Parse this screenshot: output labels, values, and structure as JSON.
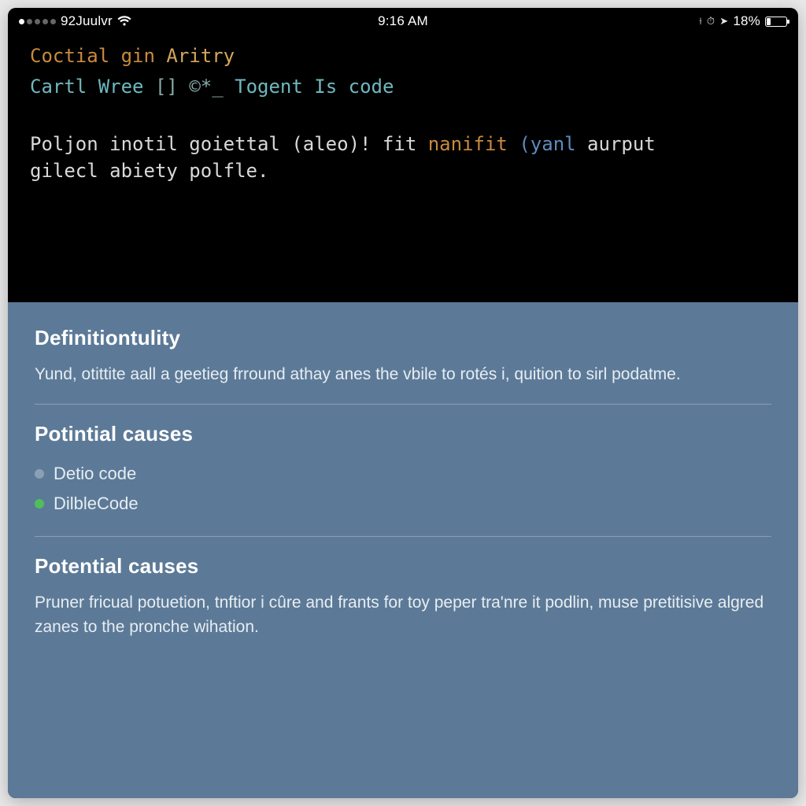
{
  "status": {
    "carrier": "92Juulvr",
    "time": "9:16 AM",
    "battery_pct": "18%"
  },
  "code": {
    "line1": {
      "a": "Coctial",
      "b": "gin",
      "c": "Aritry"
    },
    "line2": {
      "a": "Cartl Wree",
      "b": "[]",
      "c": "©*_",
      "d": "Togent Is code"
    },
    "body_plain": "Poljon inotil goiettal (aleo)! fit ",
    "body_kw": "nanifit",
    "body_paren_open": "(",
    "body_kw2": "yanl",
    "body_rest": " aurput",
    "body_line2": "gilecl abiety polfle."
  },
  "sections": {
    "s1": {
      "title": "Definitiontulity",
      "body": "Yund, otittite aall a geetieg frround athay anes the vbile to rotés i, quition to sirl podatme."
    },
    "s2": {
      "title": "Potintial causes",
      "items": [
        {
          "label": "Detio code",
          "color": "grey"
        },
        {
          "label": "DilbleCode",
          "color": "green"
        }
      ]
    },
    "s3": {
      "title": "Potential causes",
      "body": "Pruner fricual potuetion, tnftior i cûre and frants for toy peper tra'nre it podlin, muse pretitisive algred zanes to the pronche wihation."
    }
  }
}
